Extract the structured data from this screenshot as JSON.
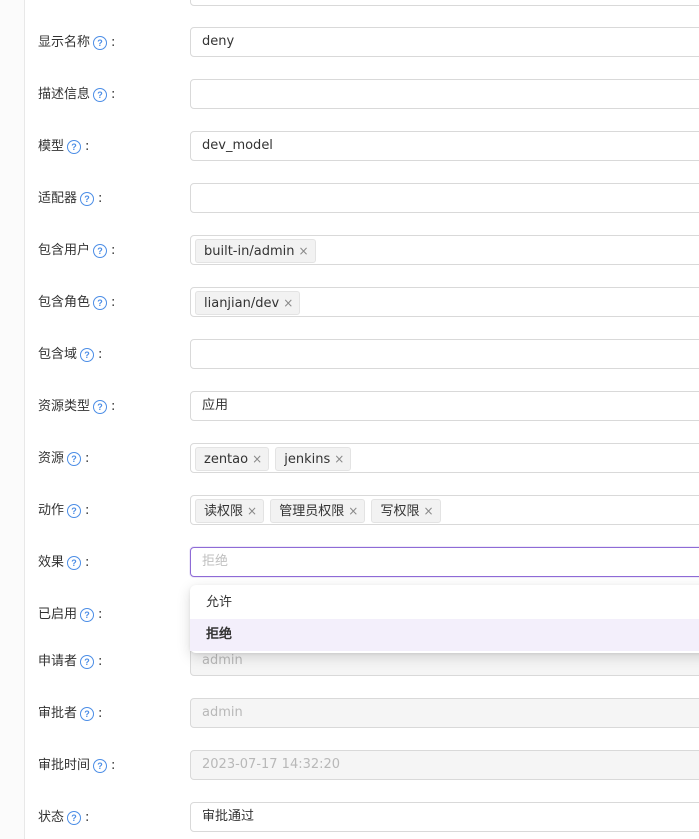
{
  "form": {
    "fields": [
      {
        "key": "display_name",
        "label": "显示名称",
        "value": "deny"
      },
      {
        "key": "description",
        "label": "描述信息",
        "value": ""
      },
      {
        "key": "model",
        "label": "模型",
        "value": "dev_model"
      },
      {
        "key": "adapter",
        "label": "适配器",
        "value": ""
      },
      {
        "key": "users",
        "label": "包含用户",
        "tags": [
          "built-in/admin"
        ]
      },
      {
        "key": "roles",
        "label": "包含角色",
        "tags": [
          "lianjian/dev"
        ]
      },
      {
        "key": "domains",
        "label": "包含域",
        "value": ""
      },
      {
        "key": "resource_type",
        "label": "资源类型",
        "value": "应用"
      },
      {
        "key": "resources",
        "label": "资源",
        "tags": [
          "zentao",
          "jenkins"
        ]
      },
      {
        "key": "actions",
        "label": "动作",
        "tags": [
          "读权限",
          "管理员权限",
          "写权限"
        ]
      },
      {
        "key": "effect",
        "label": "效果",
        "placeholder": "拒绝"
      },
      {
        "key": "enabled",
        "label": "已启用"
      },
      {
        "key": "submitter",
        "label": "申请者",
        "value": "admin"
      },
      {
        "key": "approver",
        "label": "审批者",
        "value": "admin"
      },
      {
        "key": "approve_time",
        "label": "审批时间",
        "value": "2023-07-17 14:32:20"
      },
      {
        "key": "state",
        "label": "状态",
        "value": "审批通过"
      }
    ],
    "help_glyph": "?",
    "colon": ":",
    "tag_close_glyph": "×"
  },
  "effect_dropdown": {
    "options": [
      "允许",
      "拒绝"
    ],
    "selected": "拒绝"
  },
  "colors": {
    "help_icon": "#4b8de6",
    "focus_border": "#8e6bd6",
    "selected_option_bg": "#f3effb"
  }
}
